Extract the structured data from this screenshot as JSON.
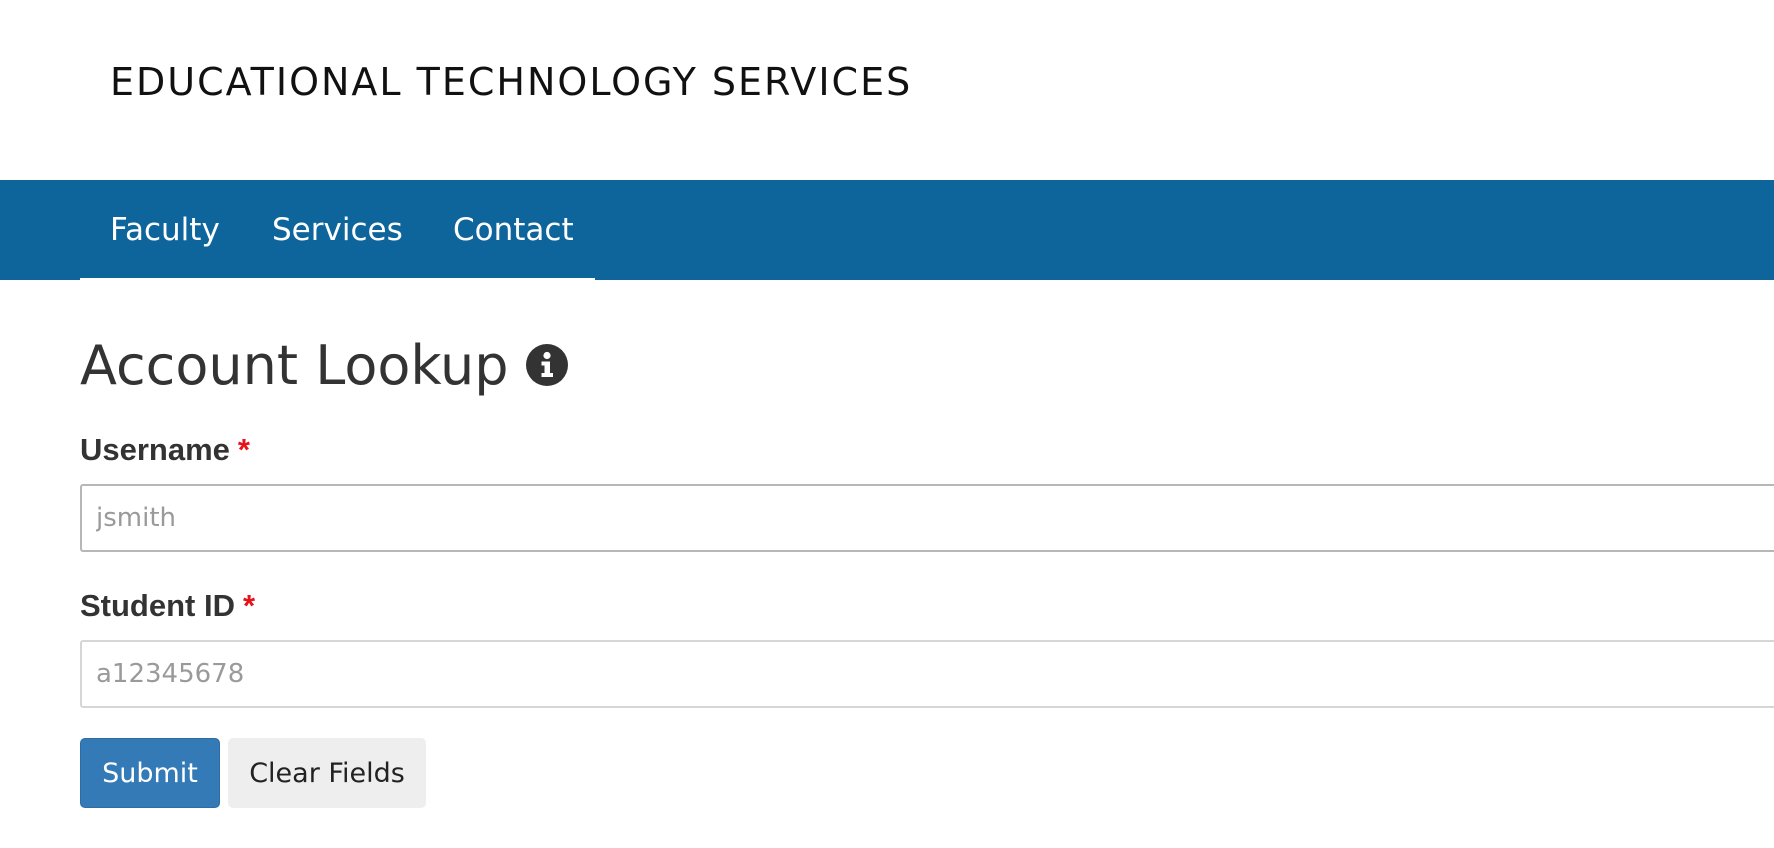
{
  "header": {
    "site_title": "EDUCATIONAL TECHNOLOGY SERVICES"
  },
  "nav": {
    "items": [
      {
        "label": "Faculty"
      },
      {
        "label": "Services"
      },
      {
        "label": "Contact"
      }
    ],
    "background_color": "#0e659c"
  },
  "page": {
    "title": "Account Lookup",
    "title_icon": "info-circle-icon"
  },
  "form": {
    "username": {
      "label": "Username",
      "required_marker": "*",
      "placeholder": "jsmith",
      "value": ""
    },
    "student_id": {
      "label": "Student ID",
      "required_marker": "*",
      "placeholder": "a12345678",
      "value": ""
    },
    "submit_label": "Submit",
    "clear_label": "Clear Fields"
  },
  "colors": {
    "primary_button": "#337ab7",
    "required": "#e8101a"
  }
}
